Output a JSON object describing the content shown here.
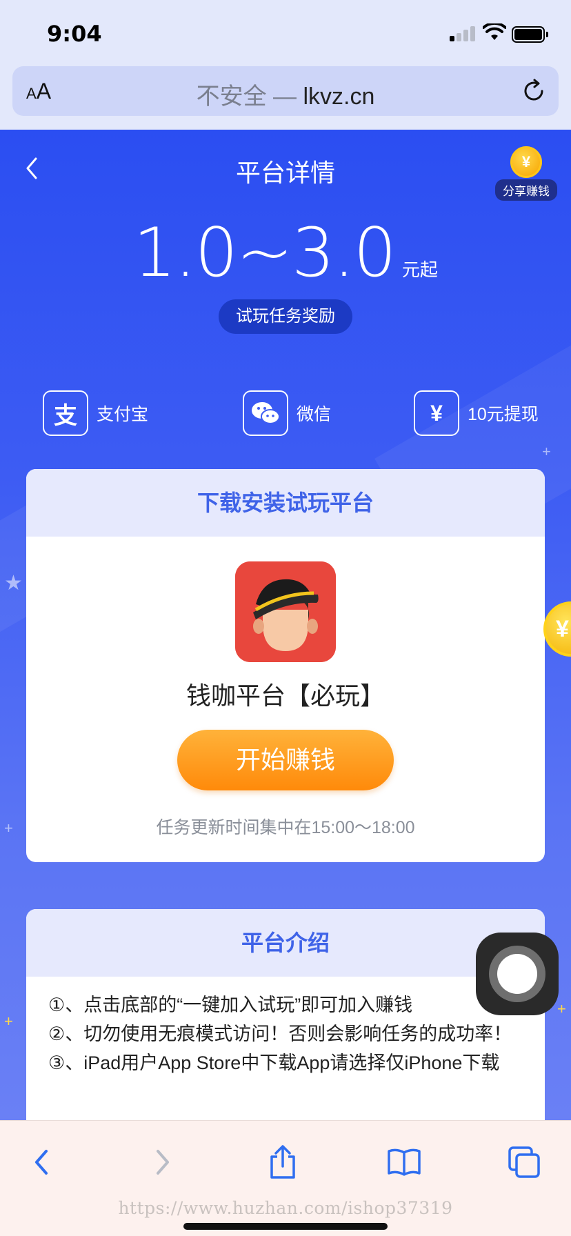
{
  "status_bar": {
    "time": "9:04"
  },
  "address_bar": {
    "aa_label_small": "A",
    "aa_label_large": "A",
    "insecure_label": "不安全",
    "separator": " — ",
    "domain": "lkvz.cn"
  },
  "header": {
    "title": "平台详情",
    "share_label": "分享赚钱",
    "share_coin_symbol": "¥"
  },
  "reward": {
    "amount": "1.0~3.0",
    "unit": "元起",
    "badge": "试玩任务奖励"
  },
  "payments": [
    {
      "label": "支付宝",
      "icon": "alipay-icon",
      "glyph": "支"
    },
    {
      "label": "微信",
      "icon": "wechat-icon"
    },
    {
      "label": "10元提现",
      "icon": "yuan-icon",
      "glyph": "¥"
    }
  ],
  "download_card": {
    "title": "下载安装试玩平台",
    "app_name": "钱咖平台【必玩】",
    "button": "开始赚钱",
    "note": "任务更新时间集中在15:00～18:00"
  },
  "intro_card": {
    "title": "平台介绍",
    "lines": [
      "①、点击底部的“一键加入试玩”即可加入赚钱",
      "②、切勿使用无痕模式访问！否则会影响任务的成功率！",
      "③、iPad用户App Store中下载App请选择仅iPhone下载"
    ]
  },
  "float_coin_symbol": "¥",
  "watermark": "https://www.huzhan.com/ishop37319",
  "colors": {
    "accent": "#3f63e8",
    "button_orange": "#ff9a1f",
    "bg_blue": "#2b4ef2"
  }
}
